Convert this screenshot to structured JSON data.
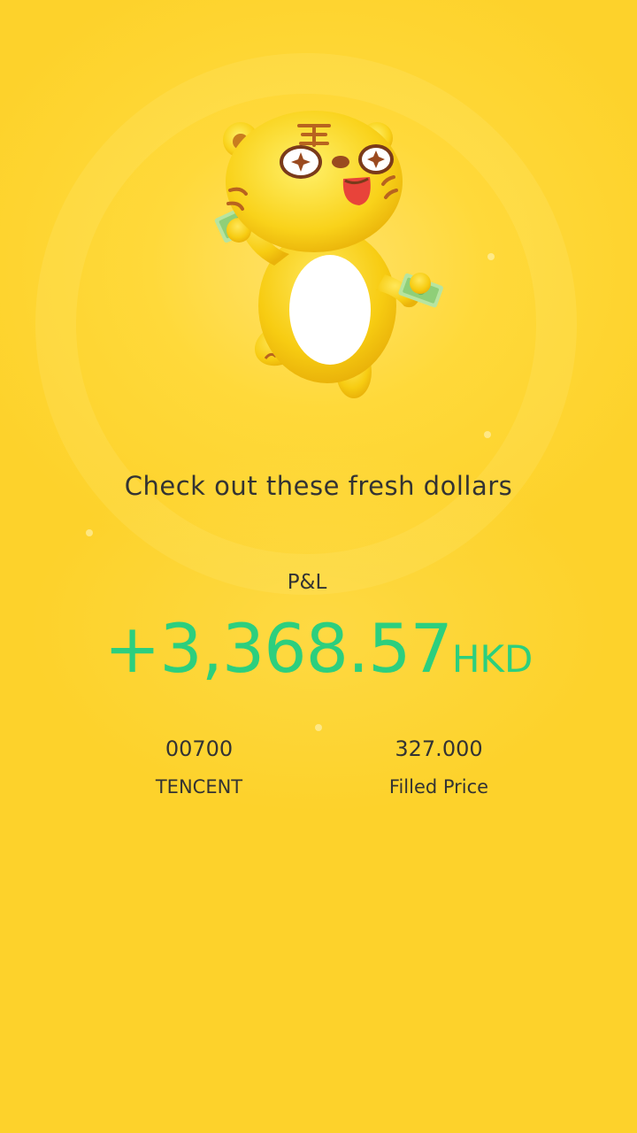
{
  "screen": {
    "background_color": "#fdd22b"
  },
  "mascot": {
    "icon": "tiger-mascot-holding-cash-icon"
  },
  "tagline": "Check out these fresh dollars",
  "pnl": {
    "label": "P&L",
    "amount": "+3,368.57",
    "currency": "HKD",
    "color": "#2ccf7e"
  },
  "stock": {
    "code": "00700",
    "name": "TENCENT"
  },
  "order": {
    "filled_price": "327.000",
    "filled_price_label": "Filled Price"
  }
}
